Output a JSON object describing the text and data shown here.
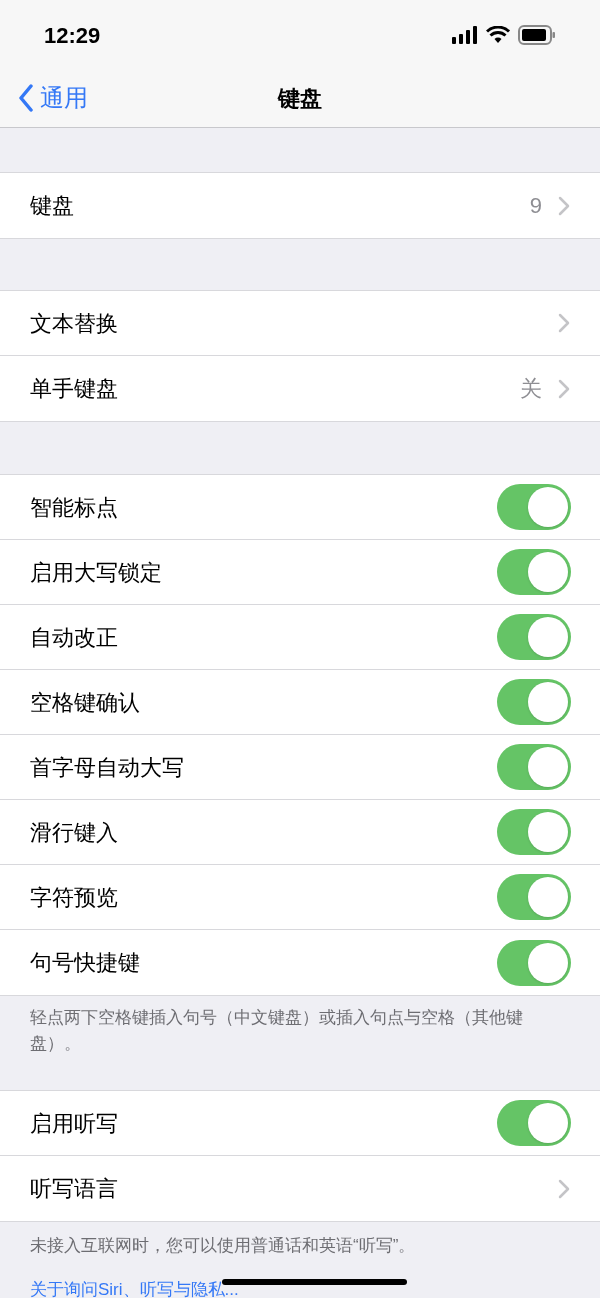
{
  "status_bar": {
    "time": "12:29"
  },
  "nav": {
    "back": "通用",
    "title": "键盘"
  },
  "sections": [
    {
      "rows": [
        {
          "kind": "link",
          "label": "键盘",
          "value": "9"
        }
      ]
    },
    {
      "rows": [
        {
          "kind": "link",
          "label": "文本替换"
        },
        {
          "kind": "link",
          "label": "单手键盘",
          "value": "关"
        }
      ]
    },
    {
      "rows": [
        {
          "kind": "toggle",
          "label": "智能标点",
          "on": true
        },
        {
          "kind": "toggle",
          "label": "启用大写锁定",
          "on": true
        },
        {
          "kind": "toggle",
          "label": "自动改正",
          "on": true
        },
        {
          "kind": "toggle",
          "label": "空格键确认",
          "on": true
        },
        {
          "kind": "toggle",
          "label": "首字母自动大写",
          "on": true
        },
        {
          "kind": "toggle",
          "label": "滑行键入",
          "on": true
        },
        {
          "kind": "toggle",
          "label": "字符预览",
          "on": true
        },
        {
          "kind": "toggle",
          "label": "句号快捷键",
          "on": true
        }
      ],
      "footer": "轻点两下空格键插入句号（中文键盘）或插入句点与空格（其他键盘）。"
    },
    {
      "rows": [
        {
          "kind": "toggle",
          "label": "启用听写",
          "on": true
        },
        {
          "kind": "link",
          "label": "听写语言"
        }
      ],
      "footer": "未接入互联网时，您可以使用普通话和英语“听写”。",
      "link": "关于询问Siri、听写与隐私..."
    }
  ]
}
